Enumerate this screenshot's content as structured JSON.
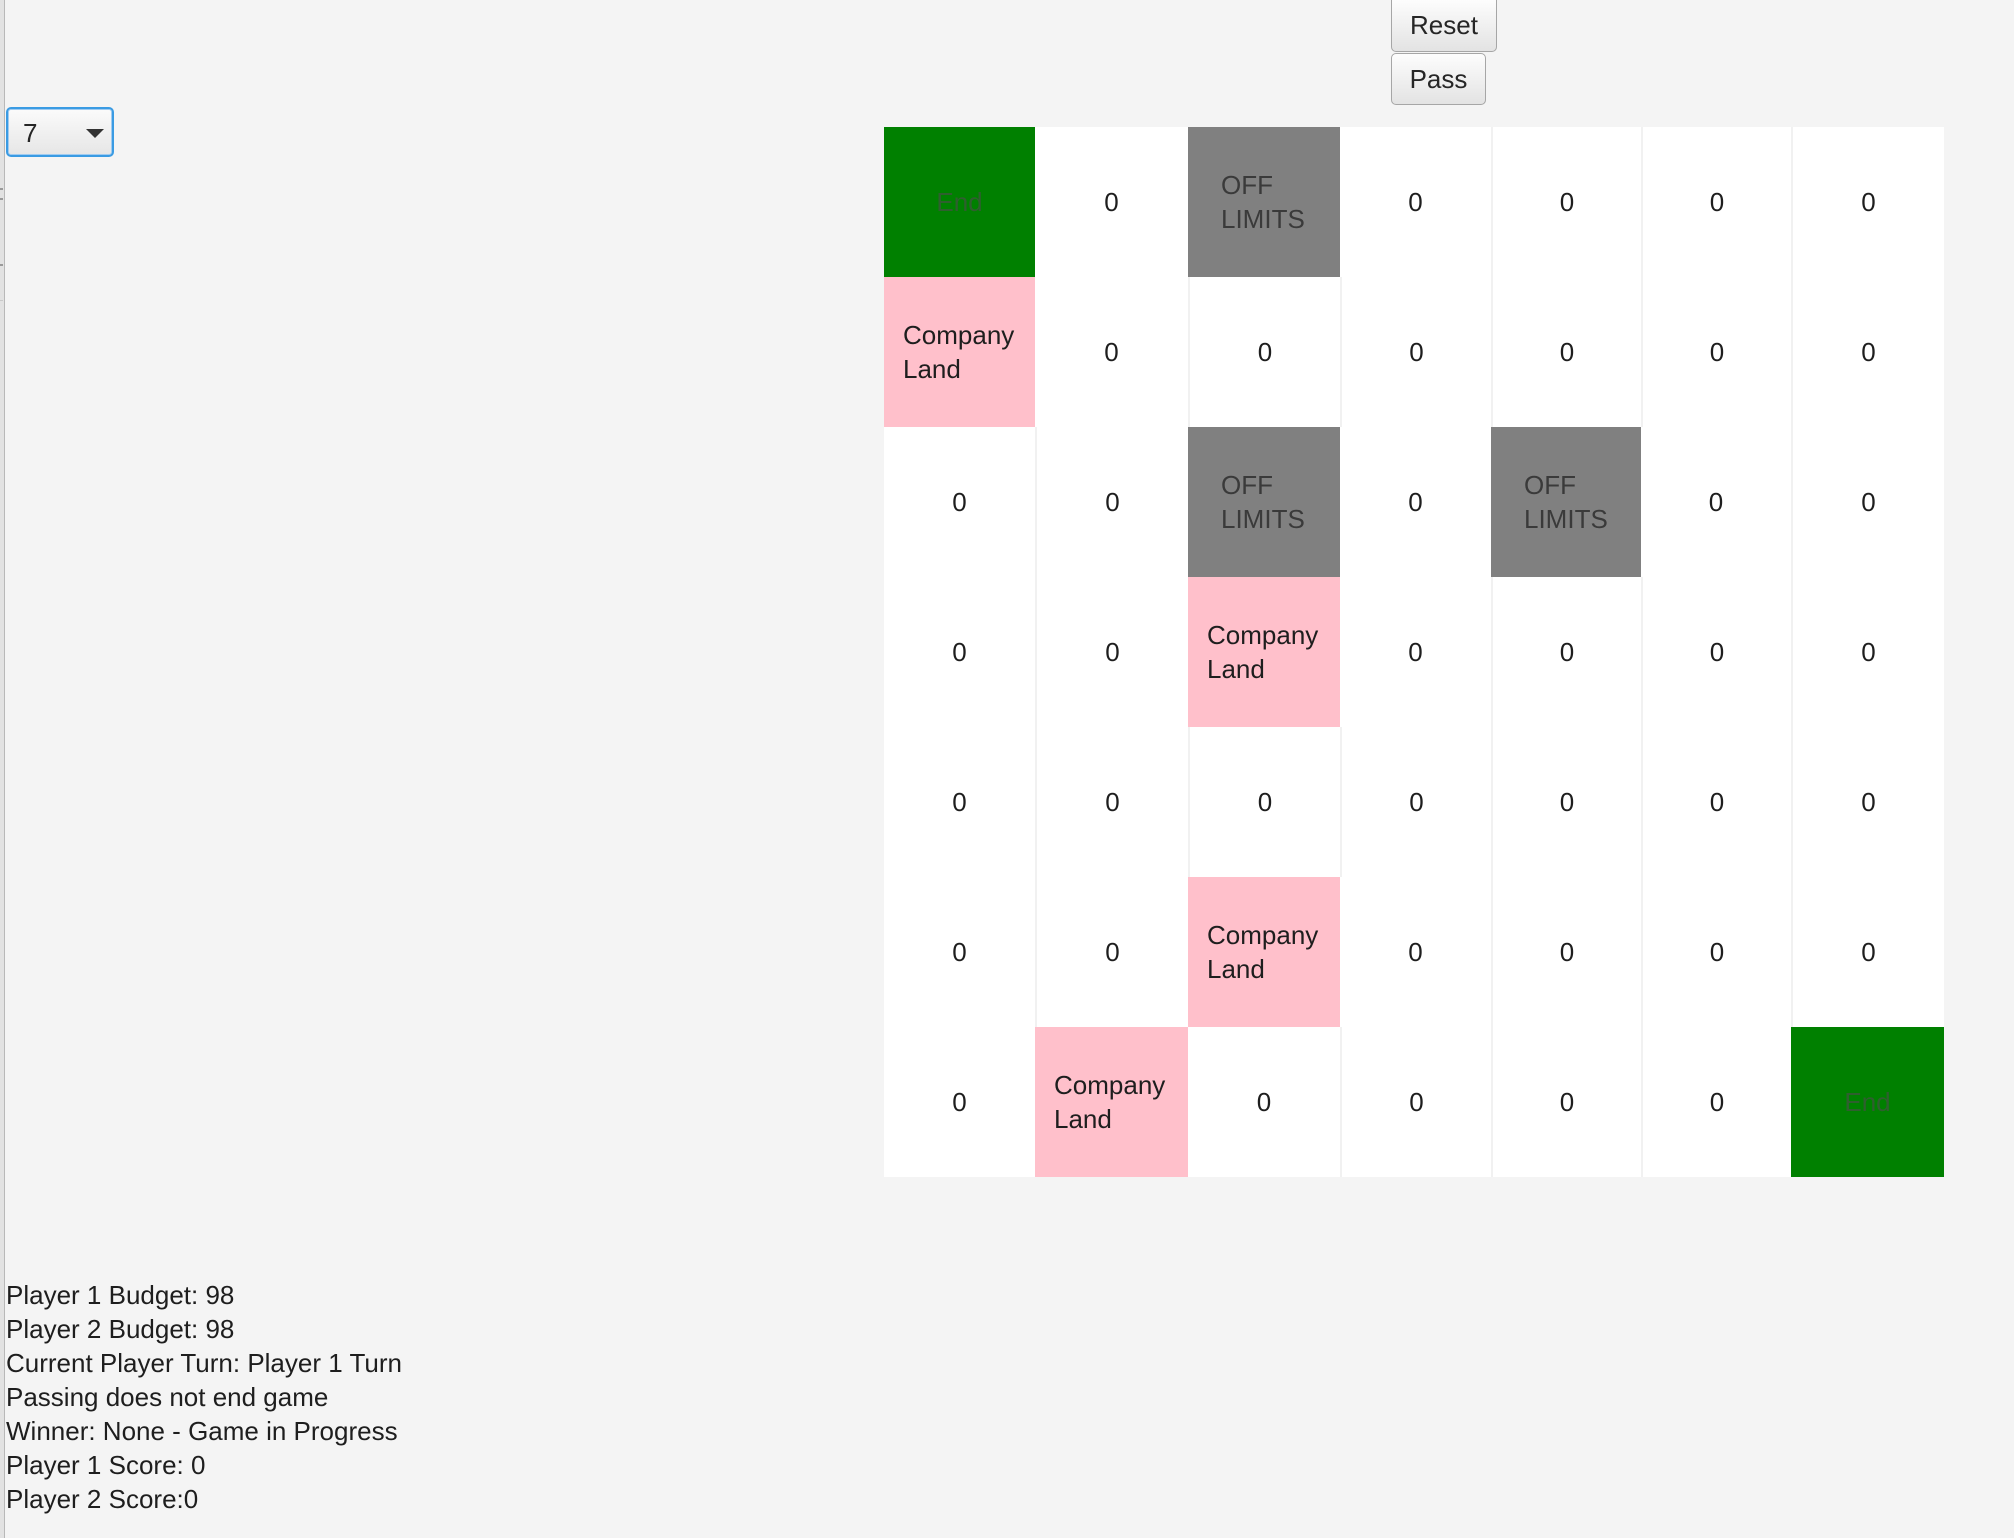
{
  "board_size_select": {
    "selected": "7"
  },
  "buttons": {
    "reset_label": "Reset",
    "pass_label": "Pass"
  },
  "colors": {
    "end": "#008000",
    "off_limits": "#808080",
    "company_land": "#ffc0cb",
    "empty": "#ffffff",
    "background": "#f4f4f4"
  },
  "board": {
    "rows": [
      [
        {
          "type": "end",
          "text": "End"
        },
        {
          "type": "number",
          "text": "0"
        },
        {
          "type": "offlimits",
          "text": "OFF\nLIMITS"
        },
        {
          "type": "number",
          "text": "0"
        },
        {
          "type": "number",
          "text": "0"
        },
        {
          "type": "number",
          "text": "0"
        },
        {
          "type": "number",
          "text": "0"
        }
      ],
      [
        {
          "type": "company",
          "text": "Company\nLand"
        },
        {
          "type": "number",
          "text": "0"
        },
        {
          "type": "number",
          "text": "0"
        },
        {
          "type": "number",
          "text": "0"
        },
        {
          "type": "number",
          "text": "0"
        },
        {
          "type": "number",
          "text": "0"
        },
        {
          "type": "number",
          "text": "0"
        }
      ],
      [
        {
          "type": "number",
          "text": "0"
        },
        {
          "type": "number",
          "text": "0"
        },
        {
          "type": "offlimits",
          "text": "OFF\nLIMITS"
        },
        {
          "type": "number",
          "text": "0"
        },
        {
          "type": "offlimits",
          "text": "OFF\nLIMITS"
        },
        {
          "type": "number",
          "text": "0"
        },
        {
          "type": "number",
          "text": "0"
        }
      ],
      [
        {
          "type": "number",
          "text": "0"
        },
        {
          "type": "number",
          "text": "0"
        },
        {
          "type": "company",
          "text": "Company\nLand"
        },
        {
          "type": "number",
          "text": "0"
        },
        {
          "type": "number",
          "text": "0"
        },
        {
          "type": "number",
          "text": "0"
        },
        {
          "type": "number",
          "text": "0"
        }
      ],
      [
        {
          "type": "number",
          "text": "0"
        },
        {
          "type": "number",
          "text": "0"
        },
        {
          "type": "number",
          "text": "0"
        },
        {
          "type": "number",
          "text": "0"
        },
        {
          "type": "number",
          "text": "0"
        },
        {
          "type": "number",
          "text": "0"
        },
        {
          "type": "number",
          "text": "0"
        }
      ],
      [
        {
          "type": "number",
          "text": "0"
        },
        {
          "type": "number",
          "text": "0"
        },
        {
          "type": "company",
          "text": "Company\nLand"
        },
        {
          "type": "number",
          "text": "0"
        },
        {
          "type": "number",
          "text": "0"
        },
        {
          "type": "number",
          "text": "0"
        },
        {
          "type": "number",
          "text": "0"
        }
      ],
      [
        {
          "type": "number",
          "text": "0"
        },
        {
          "type": "company",
          "text": "Company\nLand"
        },
        {
          "type": "number",
          "text": "0"
        },
        {
          "type": "number",
          "text": "0"
        },
        {
          "type": "number",
          "text": "0"
        },
        {
          "type": "number",
          "text": "0"
        },
        {
          "type": "end",
          "text": "End"
        }
      ]
    ]
  },
  "status": {
    "player1_budget": "Player 1 Budget: 98",
    "player2_budget": "Player 2 Budget: 98",
    "current_turn": "Current Player Turn: Player 1 Turn",
    "passing_note": "Passing does not end game",
    "winner": "Winner: None - Game in Progress",
    "player1_score": "Player 1 Score: 0",
    "player2_score": "Player 2 Score:0"
  }
}
